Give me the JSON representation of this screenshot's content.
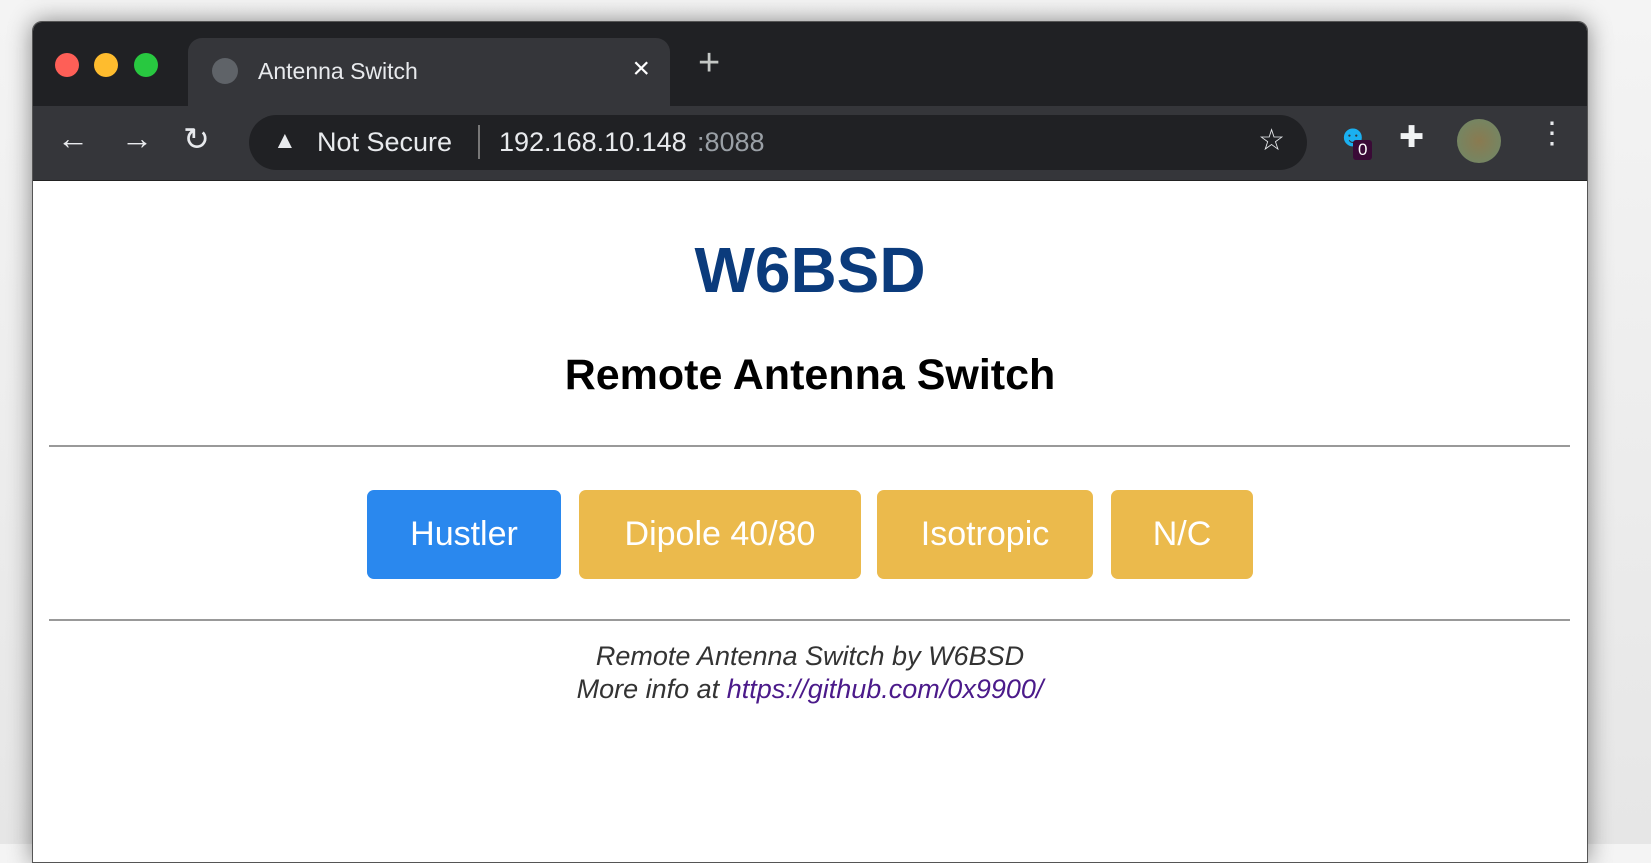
{
  "browser": {
    "tab_title": "Antenna Switch",
    "security_label": "Not Secure",
    "url_host": "192.168.10.148",
    "url_port": ":8088",
    "extension_badge": "0"
  },
  "page": {
    "callsign": "W6BSD",
    "subtitle": "Remote Antenna Switch",
    "buttons": [
      {
        "label": "Hustler",
        "color": "#2a88ee",
        "active": true
      },
      {
        "label": "Dipole 40/80",
        "color": "#ebba4c",
        "active": false
      },
      {
        "label": "Isotropic",
        "color": "#ebba4c",
        "active": false
      },
      {
        "label": "N/C",
        "color": "#ebba4c",
        "active": false
      }
    ],
    "footer": {
      "line1": "Remote Antenna Switch by W6BSD",
      "line2_prefix": "More info at ",
      "link": "https://github.com/0x9900/"
    }
  }
}
